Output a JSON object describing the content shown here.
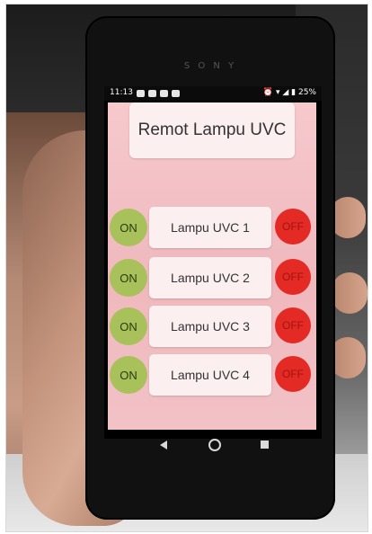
{
  "status_bar": {
    "time": "11:13",
    "right_text": "25%"
  },
  "app": {
    "title": "Remot Lampu UVC",
    "rows": [
      {
        "on_label": "ON",
        "lamp_label": "Lampu UVC 1",
        "off_label": "OFF"
      },
      {
        "on_label": "ON",
        "lamp_label": "Lampu UVC 2",
        "off_label": "OFF"
      },
      {
        "on_label": "ON",
        "lamp_label": "Lampu UVC 3",
        "off_label": "OFF"
      },
      {
        "on_label": "ON",
        "lamp_label": "Lampu UVC 4",
        "off_label": "OFF"
      }
    ]
  },
  "colors": {
    "on_button": "#a9c15a",
    "off_button": "#e42a24",
    "app_background": "#f2c2c6",
    "card_background": "#fbeff0"
  },
  "icons": {
    "nav": [
      "back-icon",
      "home-icon",
      "recent-apps-icon"
    ],
    "status": [
      "alarm-icon",
      "wifi-icon",
      "signal-icon",
      "battery-icon"
    ]
  }
}
